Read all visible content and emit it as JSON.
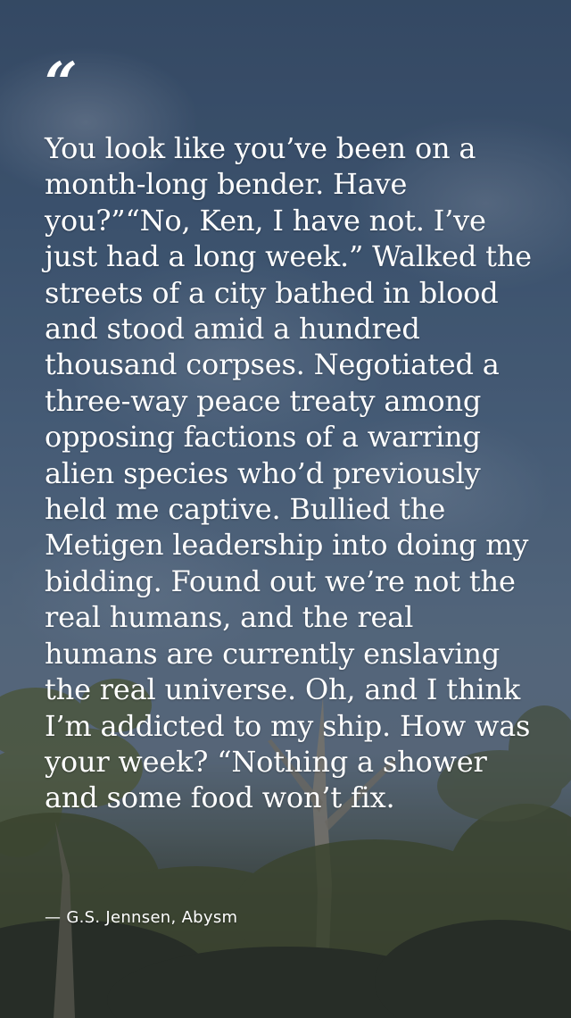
{
  "quote_mark": "“",
  "quote": "You look like you’ve been on a month-long bender. Have you?”“No, Ken, I have not. I’ve just had a long week.” Walked the streets of a city bathed in blood and stood amid a hundred thousand corpses. Negotiated a three-way peace treaty among opposing factions of a warring alien species who’d previously held me captive. Bullied the Metigen leadership into doing my bidding. Found out we’re not the real humans, and the real humans are currently enslaving the real universe. Oh, and I think I’m addicted to my ship. How was your week? “Nothing a shower and some food won’t fix.",
  "attribution": "— G.S. Jennsen, Abysm",
  "background": {
    "description_icon": "sky-with-trees-icon",
    "sky_color": "#4a6685",
    "foliage_color": "#3a4230"
  }
}
